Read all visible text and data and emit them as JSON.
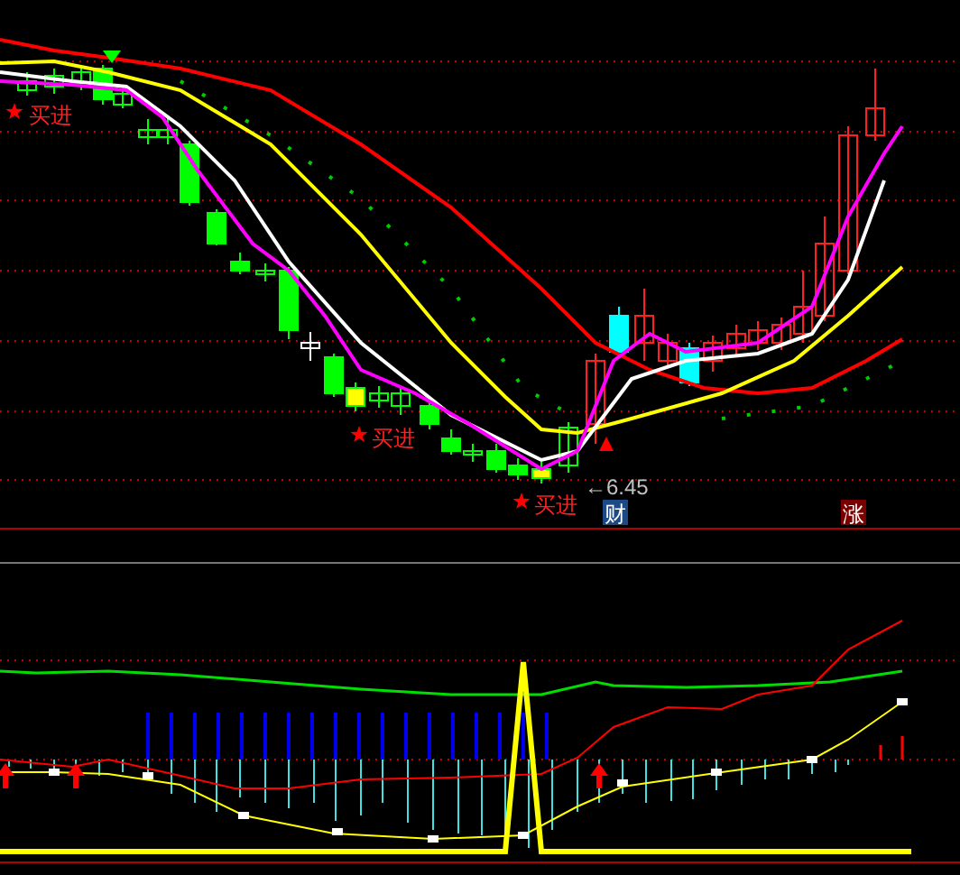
{
  "signals": [
    {
      "text": "买进"
    },
    {
      "text": "买进"
    },
    {
      "text": "买进"
    }
  ],
  "price_label": "←6.45",
  "badges": [
    {
      "text": "财",
      "color": "#1c4a86"
    },
    {
      "text": "涨",
      "color": "#7a0000"
    }
  ]
}
